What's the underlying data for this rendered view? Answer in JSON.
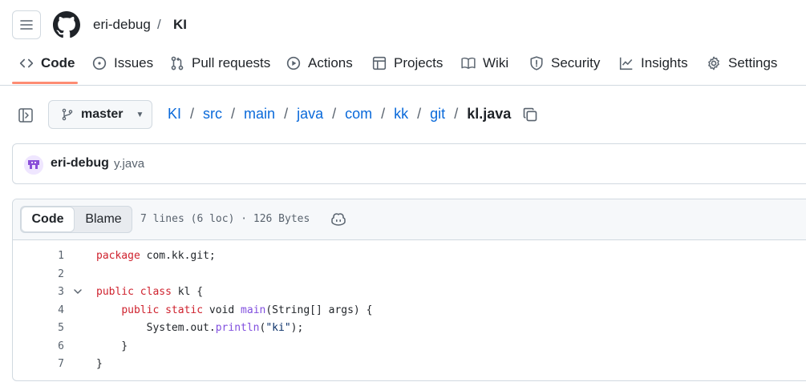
{
  "header": {
    "owner": "eri-debug",
    "separator": "/",
    "repo": "KI"
  },
  "nav": {
    "items": [
      {
        "label": "Code",
        "icon": "code-icon",
        "active": true
      },
      {
        "label": "Issues",
        "icon": "issue-opened-icon"
      },
      {
        "label": "Pull requests",
        "icon": "git-pull-request-icon"
      },
      {
        "label": "Actions",
        "icon": "play-icon"
      },
      {
        "label": "Projects",
        "icon": "table-icon"
      },
      {
        "label": "Wiki",
        "icon": "book-icon"
      },
      {
        "label": "Security",
        "icon": "shield-icon"
      },
      {
        "label": "Insights",
        "icon": "graph-icon"
      },
      {
        "label": "Settings",
        "icon": "gear-icon"
      }
    ],
    "accent_color": "#fd8c73"
  },
  "pathbar": {
    "branch": "master",
    "segments": [
      "KI",
      "src",
      "main",
      "java",
      "com",
      "kk",
      "git"
    ],
    "separator": "/",
    "file": "kl.java"
  },
  "commit": {
    "author": "eri-debug",
    "message": "y.java"
  },
  "file": {
    "tab_code": "Code",
    "tab_blame": "Blame",
    "meta": "7 lines (6 loc) · 126 Bytes",
    "lines": [
      {
        "num": "1",
        "tokens": [
          {
            "t": "package",
            "c": "kw"
          },
          {
            "t": " com.kk.git;",
            "c": ""
          }
        ]
      },
      {
        "num": "2",
        "tokens": []
      },
      {
        "num": "3",
        "fold": true,
        "tokens": [
          {
            "t": "public",
            "c": "kw"
          },
          {
            "t": " ",
            "c": ""
          },
          {
            "t": "class",
            "c": "kw"
          },
          {
            "t": " kl {",
            "c": ""
          }
        ]
      },
      {
        "num": "4",
        "tokens": [
          {
            "t": "    ",
            "c": ""
          },
          {
            "t": "public",
            "c": "kw"
          },
          {
            "t": " ",
            "c": ""
          },
          {
            "t": "static",
            "c": "kw"
          },
          {
            "t": " void ",
            "c": ""
          },
          {
            "t": "main",
            "c": "fn"
          },
          {
            "t": "(String[] args) {",
            "c": ""
          }
        ]
      },
      {
        "num": "5",
        "tokens": [
          {
            "t": "        System.out.",
            "c": ""
          },
          {
            "t": "println",
            "c": "fn"
          },
          {
            "t": "(",
            "c": ""
          },
          {
            "t": "\"ki\"",
            "c": "str"
          },
          {
            "t": ");",
            "c": ""
          }
        ]
      },
      {
        "num": "6",
        "tokens": [
          {
            "t": "    }",
            "c": ""
          }
        ]
      },
      {
        "num": "7",
        "tokens": [
          {
            "t": "}",
            "c": ""
          }
        ]
      }
    ]
  }
}
